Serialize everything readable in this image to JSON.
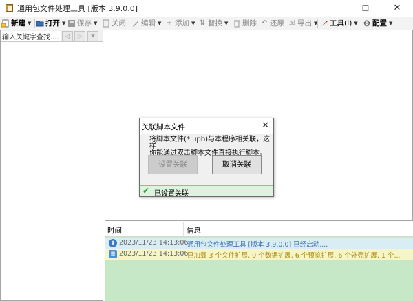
{
  "window": {
    "title": "通用包文件处理工具 [版本 3.9.0.0]",
    "minimize": "—",
    "maximize": "☐",
    "close": "✕"
  },
  "toolbar": {
    "new": "新建",
    "open": "打开",
    "save": "保存",
    "close": "关闭",
    "edit": "编辑",
    "add": "添加",
    "replace": "替换",
    "delete": "删除",
    "restore": "还原",
    "export": "导出",
    "tools": "工具(I)",
    "config": "配置"
  },
  "search": {
    "value": "输入关键字查找...."
  },
  "log": {
    "col_time": "时间",
    "col_info": "信息",
    "rows": [
      {
        "time": "2023/11/23 14:13:06",
        "message": "通用包文件处理工具 [版本 3.9.0.0] 已经启动....",
        "kind": "info"
      },
      {
        "time": "2023/11/23 14:13:06",
        "message": "已加载 3 个文件扩展, 0 个数据扩展, 6 个预览扩展, 6 个外壳扩展, 1 个...",
        "kind": "message"
      }
    ]
  },
  "dialog": {
    "title": "关联脚本文件",
    "close": "✕",
    "message_line1": "将脚本文件(*.upb)与本程序相关联，这样",
    "message_line2": "你能通过双击脚本文件直接执行脚本。",
    "btn_set": "设置关联",
    "btn_cancel": "取消关联",
    "status": "已设置关联"
  },
  "colors": {
    "log_background": "#c6e8c6",
    "info_row": "#d8eef4",
    "message_row": "#f5f5c8",
    "info_text": "#3f6fb0",
    "message_text": "#b08a10",
    "check": "#2e9a2e"
  }
}
